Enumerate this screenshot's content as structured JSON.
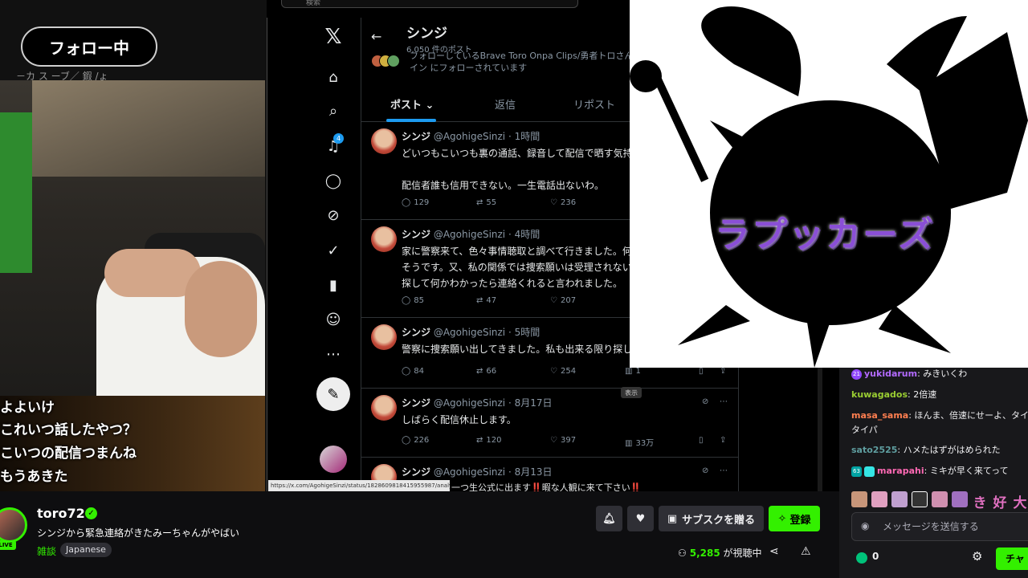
{
  "stream_overlay": {
    "follow_label": "フォロー中",
    "cut_text": "－カ ス ーブ／ 鍜 /ょ",
    "captions": [
      "よよいけ",
      "これいつ話したやつ？",
      "こいつの配信つまんね",
      "もうあきた"
    ],
    "overlay_text": "ラプッカーズ"
  },
  "twitter": {
    "search_placeholder": "検索",
    "profile_name": "シンジ",
    "post_count": "6,050 件のポスト",
    "followed_by": "フォローしているBrave Toro Onpa Clips/勇者トロさん、イン にフォローされています",
    "notif_count": "4",
    "tabs": {
      "posts": "ポスト",
      "replies": "返信",
      "reposts": "リポスト"
    },
    "tweets": [
      {
        "name": "シンジ",
        "handle": "@AgohigeSinzi · 1時間",
        "line1": "どいつもこいつも裏の通話、録音して配信で晒す気持",
        "line2": "",
        "line3": "配信者誰も信用できない。一生電話出ないわ。",
        "replies": "129",
        "retweets": "55",
        "likes": "236",
        "views": ""
      },
      {
        "name": "シンジ",
        "handle": "@AgohigeSinzi · 4時間",
        "line1": "家に警察来て、色々事情聴取と調べて行きました。何",
        "line2": "そうです。又、私の関係では捜索願いは受理されない",
        "line3": "探して何かわかったら連絡くれると言われました。",
        "replies": "85",
        "retweets": "47",
        "likes": "207",
        "views": ""
      },
      {
        "name": "シンジ",
        "handle": "@AgohigeSinzi · 5時間",
        "line1": "警察に捜索願い出してきました。私も出来る限り探し",
        "line2": "",
        "line3": "",
        "replies": "84",
        "retweets": "66",
        "likes": "254",
        "views": "1"
      },
      {
        "name": "シンジ",
        "handle": "@AgohigeSinzi · 8月17日",
        "line1": "しばらく配信休止します。",
        "line2": "",
        "line3": "",
        "replies": "226",
        "retweets": "120",
        "likes": "397",
        "views": "33万"
      },
      {
        "name": "シンジ",
        "handle": "@AgohigeSinzi · 8月13日",
        "line1": "一つ生公式に出ます‼️暇な人観に来て下さい‼️",
        "line2": "",
        "line3": "",
        "replies": "",
        "retweets": "",
        "likes": "",
        "views": ""
      }
    ],
    "tooltip": "表示",
    "status_url": "https://x.com/AgohigeSinzi/status/1828609818415955987/analyt..."
  },
  "chat": {
    "messages": [
      {
        "user": "yukidarum",
        "text": ": みきいくわ",
        "color": "#b36bff",
        "badge": "21"
      },
      {
        "user": "kuwagados",
        "text": ": 2倍速",
        "color": "#9acd32",
        "badge": ""
      },
      {
        "user": "masa_sama",
        "text": ": ほんま、倍速にせーよ、タイ",
        "color": "#ff7f50",
        "badge": ""
      },
      {
        "user": "",
        "text": "タイパ",
        "color": "#efeff1",
        "badge": ""
      },
      {
        "user": "sato2525",
        "text": ": ハメたはずがはめられた",
        "color": "#5f9ea0",
        "badge": ""
      },
      {
        "user": "marapahi",
        "text": ": ミキが早く来てって",
        "color": "#ff69b4",
        "badge": "63"
      }
    ],
    "emote_glyphs": [
      "き",
      "好",
      "大"
    ],
    "input_placeholder": "メッセージを送信する",
    "points": "0",
    "send_label": "チャ"
  },
  "stream_info": {
    "streamer": "toro72",
    "live_label": "LIVE",
    "title": "シンジから緊急連絡がきたみーちゃんがやばい",
    "category": "雑談",
    "tag": "Japanese",
    "gift_label": "サブスクを贈る",
    "subscribe_label": "登録",
    "viewer_count": "5,285",
    "viewer_suffix": " が視聴中"
  },
  "colors": {
    "accent": "#33f000",
    "twitter_blue": "#1d9bf0",
    "overlay_purple": "#8a4fd6"
  }
}
